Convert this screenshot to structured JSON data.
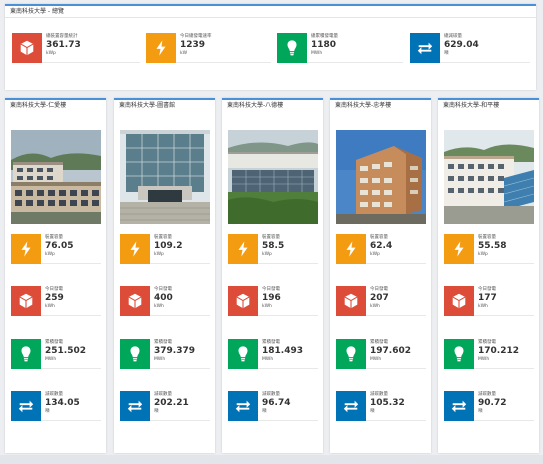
{
  "overview": {
    "title": "東南科技大學 - 總覽",
    "tiles": [
      {
        "label": "總裝置容量統計",
        "value": "361.73",
        "unit": "kWp",
        "color": "#dd4b39",
        "icon": "cube-icon"
      },
      {
        "label": "今日總發電速率",
        "value": "1239",
        "unit": "kW",
        "color": "#f39c12",
        "icon": "lightning-icon"
      },
      {
        "label": "總累積發電量",
        "value": "1180",
        "unit": "MWh",
        "color": "#00a65a",
        "icon": "lightbulb-icon"
      },
      {
        "label": "總減碳量",
        "value": "629.04",
        "unit": "噸",
        "color": "#0073b7",
        "icon": "exchange-icon"
      }
    ]
  },
  "buildings": [
    {
      "title": "東南科技大學-仁愛樓",
      "stats": [
        {
          "label": "裝置容量",
          "value": "76.05",
          "unit": "kWp"
        },
        {
          "label": "今日發電",
          "value": "259",
          "unit": "kWh"
        },
        {
          "label": "累積發電",
          "value": "251.502",
          "unit": "MWh"
        },
        {
          "label": "減碳數量",
          "value": "134.05",
          "unit": "噸"
        }
      ]
    },
    {
      "title": "東南科技大學-圖書館",
      "stats": [
        {
          "label": "裝置容量",
          "value": "109.2",
          "unit": "kWp"
        },
        {
          "label": "今日發電",
          "value": "400",
          "unit": "kWh"
        },
        {
          "label": "累積發電",
          "value": "379.379",
          "unit": "MWh"
        },
        {
          "label": "減碳數量",
          "value": "202.21",
          "unit": "噸"
        }
      ]
    },
    {
      "title": "東南科技大學-八德樓",
      "stats": [
        {
          "label": "裝置容量",
          "value": "58.5",
          "unit": "kWp"
        },
        {
          "label": "今日發電",
          "value": "196",
          "unit": "kWh"
        },
        {
          "label": "累積發電",
          "value": "181.493",
          "unit": "MWh"
        },
        {
          "label": "減碳數量",
          "value": "96.74",
          "unit": "噸"
        }
      ]
    },
    {
      "title": "東南科技大學-忠孝樓",
      "stats": [
        {
          "label": "裝置容量",
          "value": "62.4",
          "unit": "kWp"
        },
        {
          "label": "今日發電",
          "value": "207",
          "unit": "kWh"
        },
        {
          "label": "累積發電",
          "value": "197.602",
          "unit": "MWh"
        },
        {
          "label": "減碳數量",
          "value": "105.32",
          "unit": "噸"
        }
      ]
    },
    {
      "title": "東南科技大學-和平樓",
      "stats": [
        {
          "label": "裝置容量",
          "value": "55.58",
          "unit": "kWp"
        },
        {
          "label": "今日發電",
          "value": "177",
          "unit": "kWh"
        },
        {
          "label": "累積發電",
          "value": "170.212",
          "unit": "MWh"
        },
        {
          "label": "減碳數量",
          "value": "90.72",
          "unit": "噸"
        }
      ]
    }
  ],
  "stat_styles": [
    {
      "color": "#f39c12",
      "icon": "lightning-icon"
    },
    {
      "color": "#dd4b39",
      "icon": "cube-icon"
    },
    {
      "color": "#00a65a",
      "icon": "lightbulb-icon"
    },
    {
      "color": "#0073b7",
      "icon": "exchange-icon"
    }
  ]
}
